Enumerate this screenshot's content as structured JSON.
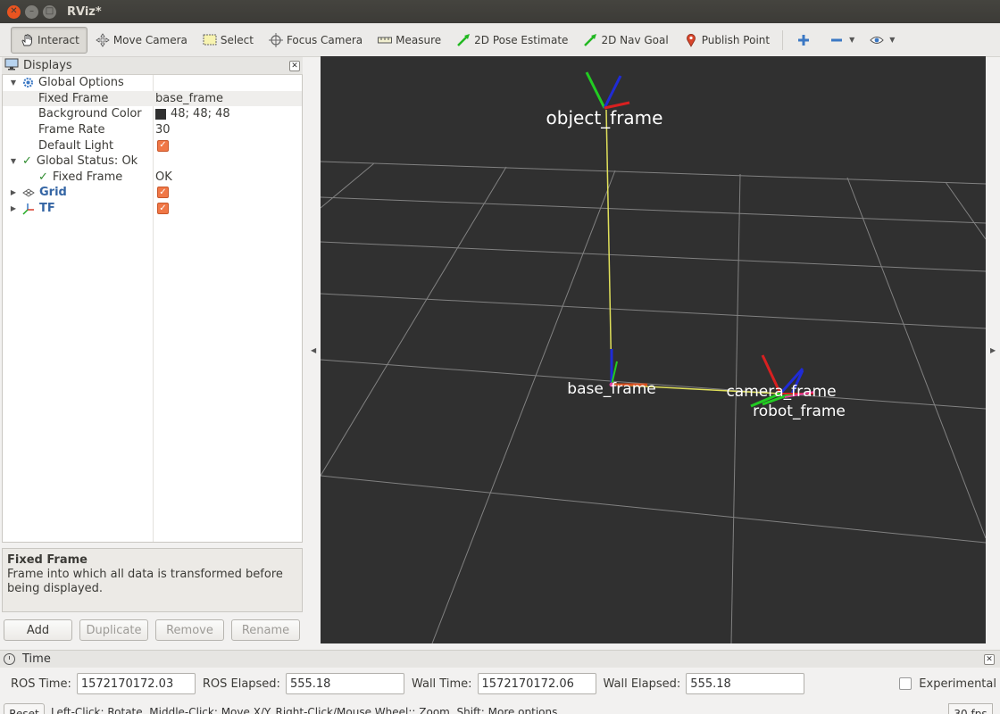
{
  "window": {
    "title": "RViz*"
  },
  "toolbar": {
    "tools": [
      {
        "label": "Interact",
        "icon": "hand-icon",
        "active": true
      },
      {
        "label": "Move Camera",
        "icon": "move-camera-icon"
      },
      {
        "label": "Select",
        "icon": "select-icon"
      },
      {
        "label": "Focus Camera",
        "icon": "focus-icon"
      },
      {
        "label": "Measure",
        "icon": "ruler-icon"
      },
      {
        "label": "2D Pose Estimate",
        "icon": "green-arrow-icon"
      },
      {
        "label": "2D Nav Goal",
        "icon": "green-arrow-icon"
      },
      {
        "label": "Publish Point",
        "icon": "map-pin-icon"
      }
    ]
  },
  "displays": {
    "title": "Displays",
    "rows": [
      {
        "name": "Global Options",
        "value": ""
      },
      {
        "name": "Fixed Frame",
        "value": "base_frame"
      },
      {
        "name": "Background Color",
        "value": "48; 48; 48"
      },
      {
        "name": "Frame Rate",
        "value": "30"
      },
      {
        "name": "Default Light",
        "value": ""
      },
      {
        "name": "Global Status: Ok",
        "value": ""
      },
      {
        "name": "Fixed Frame",
        "value": "OK"
      },
      {
        "name": "Grid",
        "value": ""
      },
      {
        "name": "TF",
        "value": ""
      }
    ],
    "description": {
      "title": "Fixed Frame",
      "text": "Frame into which all data is transformed before being displayed."
    },
    "buttons": {
      "add": "Add",
      "duplicate": "Duplicate",
      "remove": "Remove",
      "rename": "Rename"
    }
  },
  "view": {
    "background": "#303030",
    "frames": {
      "object": "object_frame",
      "base": "base_frame",
      "camera": "camera_frame",
      "robot": "robot_frame"
    }
  },
  "time": {
    "title": "Time",
    "ros_time_label": "ROS Time:",
    "ros_time": "1572170172.03",
    "ros_elapsed_label": "ROS Elapsed:",
    "ros_elapsed": "555.18",
    "wall_time_label": "Wall Time:",
    "wall_time": "1572170172.06",
    "wall_elapsed_label": "Wall Elapsed:",
    "wall_elapsed": "555.18",
    "experimental_label": "Experimental"
  },
  "status": {
    "reset": "Reset",
    "hint": "Left-Click: Rotate. Middle-Click: Move X/Y. Right-Click/Mouse Wheel:: Zoom. Shift: More options.",
    "fps": "30 fps"
  },
  "colors": {
    "accent": "#f07746",
    "link_blue": "#3465a4",
    "ok_green": "#2e8b2e"
  }
}
